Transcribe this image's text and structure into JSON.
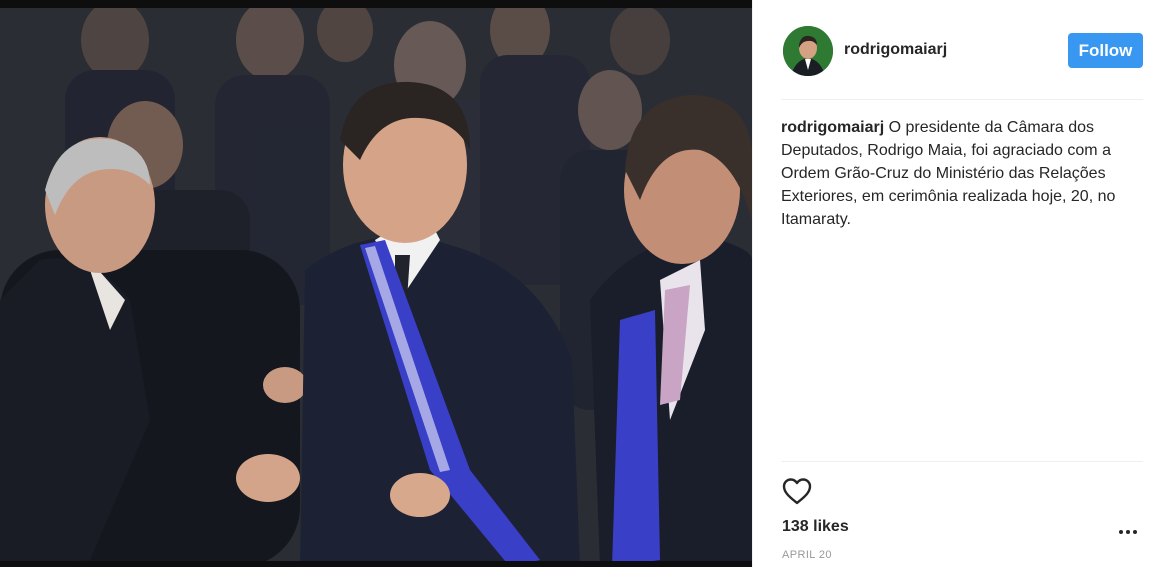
{
  "post": {
    "username": "rodrigomaiarj",
    "follow_label": "Follow",
    "caption_user": "rodrigomaiarj",
    "caption_text": " O presidente da Câmara dos Deputados, Rodrigo Maia, foi agraciado com a Ordem Grão-Cruz do Ministério das Relações Exteriores, em cerimônia realizada hoje, 20, no Itamaraty.",
    "likes": "138 likes",
    "date": "APRIL 20"
  },
  "colors": {
    "follow_button": "#3897f0",
    "text": "#262626",
    "muted": "#999999",
    "sash": "#3a3fc8"
  },
  "icons": [
    "heart-icon",
    "more-options-icon"
  ]
}
